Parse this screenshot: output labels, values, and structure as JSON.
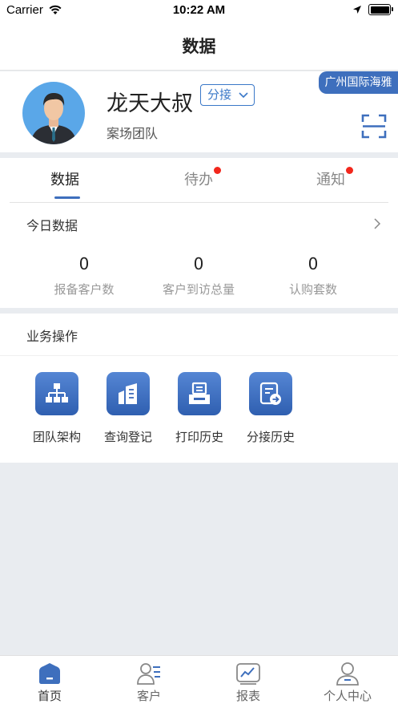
{
  "status_bar": {
    "carrier": "Carrier",
    "time": "10:22 AM"
  },
  "nav": {
    "title": "数据"
  },
  "profile": {
    "name": "龙天大叔",
    "role_button": "分接",
    "team": "案场团队",
    "project_tag": "广州国际海雅"
  },
  "tabs": [
    {
      "label": "数据",
      "active": true,
      "badge": false
    },
    {
      "label": "待办",
      "active": false,
      "badge": true
    },
    {
      "label": "通知",
      "active": false,
      "badge": true
    }
  ],
  "today": {
    "title": "今日数据",
    "stats": [
      {
        "value": "0",
        "label": "报备客户数"
      },
      {
        "value": "0",
        "label": "客户到访总量"
      },
      {
        "value": "0",
        "label": "认购套数"
      }
    ]
  },
  "operations": {
    "title": "业务操作",
    "items": [
      {
        "label": "团队架构",
        "icon": "org-chart-icon"
      },
      {
        "label": "查询登记",
        "icon": "building-icon"
      },
      {
        "label": "打印历史",
        "icon": "printer-icon"
      },
      {
        "label": "分接历史",
        "icon": "document-forward-icon"
      }
    ]
  },
  "tabbar": {
    "items": [
      {
        "label": "首页",
        "icon": "home-icon",
        "active": true
      },
      {
        "label": "客户",
        "icon": "customer-icon",
        "active": false
      },
      {
        "label": "报表",
        "icon": "report-icon",
        "active": false
      },
      {
        "label": "个人中心",
        "icon": "profile-icon",
        "active": false
      }
    ]
  },
  "colors": {
    "accent": "#3e6fbd",
    "badge": "#f2271c",
    "background": "#e9ecf0"
  }
}
